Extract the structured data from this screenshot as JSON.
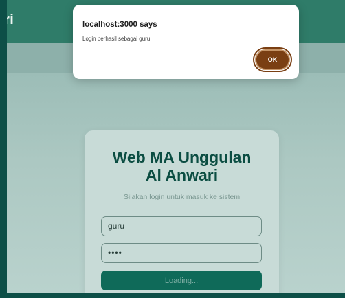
{
  "header": {
    "brand_fragment": "ri"
  },
  "login": {
    "title_line1": "Web MA Unggulan",
    "title_line2": "Al Anwari",
    "subtitle": "Silakan login untuk masuk ke sistem",
    "username_value": "guru",
    "password_value": "••••",
    "submit_label": "Loading..."
  },
  "alert": {
    "title": "localhost:3000 says",
    "message": "Login berhasil sebagai guru",
    "ok_label": "OK"
  },
  "colors": {
    "header": "#2f7c69",
    "title": "#0b4d42",
    "button": "#0f6a59",
    "ok_button": "#7a3f13"
  }
}
